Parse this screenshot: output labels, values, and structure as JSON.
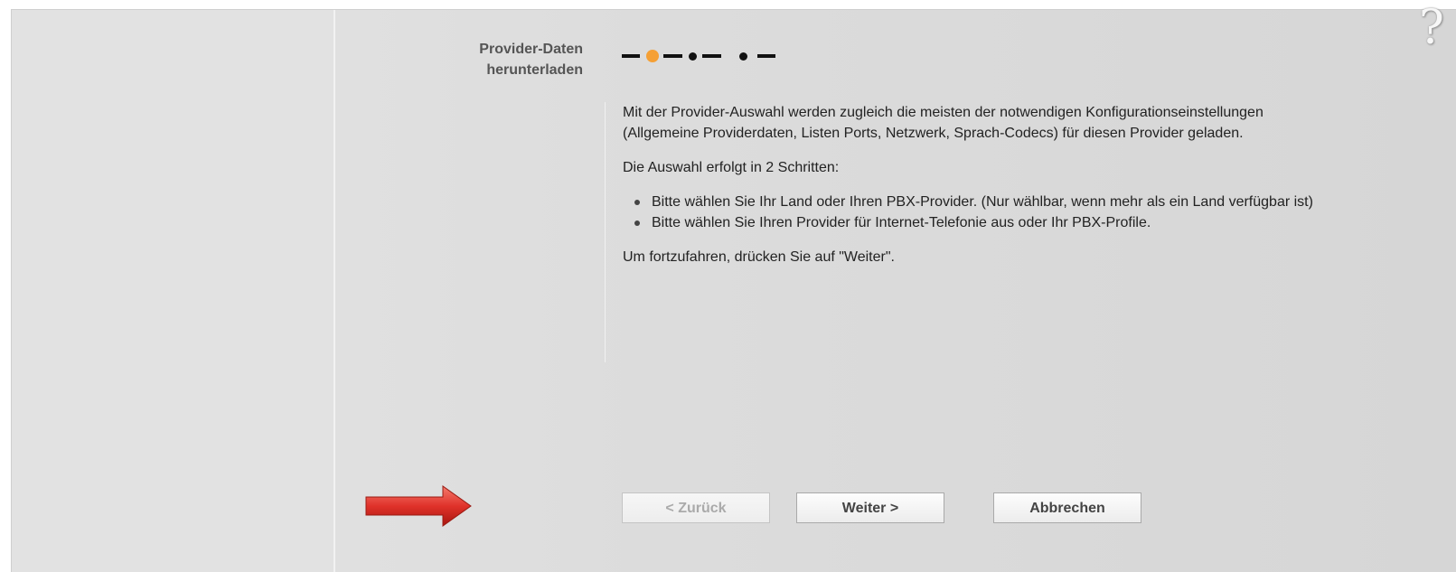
{
  "wizard": {
    "step_title_line1": "Provider-Daten",
    "step_title_line2": "herunterladen",
    "step_indicator": {
      "total_steps": 3,
      "current_step": 1,
      "active_color": "#f5a035",
      "inactive_color": "#111111"
    }
  },
  "content": {
    "intro": "Mit der Provider-Auswahl werden zugleich die meisten der notwendigen Konfigurationseinstellungen (Allgemeine Providerdaten, Listen Ports, Netzwerk, Sprach-Codecs) für diesen Provider geladen.",
    "steps_intro": "Die Auswahl erfolgt in 2 Schritten:",
    "steps": [
      "Bitte wählen Sie Ihr Land oder Ihren PBX-Provider. (Nur wählbar, wenn mehr als ein Land verfügbar ist)",
      "Bitte wählen Sie Ihren Provider für Internet-Telefonie aus oder Ihr PBX-Profile."
    ],
    "continue_hint": "Um fortzufahren, drücken Sie auf \"Weiter\"."
  },
  "buttons": {
    "back": "< Zurück",
    "next": "Weiter >",
    "cancel": "Abbrechen"
  },
  "help_icon": {
    "glyph": "?",
    "icon": "question-mark-icon"
  },
  "arrow": {
    "icon": "right-arrow-icon",
    "color": "#e0322a"
  }
}
